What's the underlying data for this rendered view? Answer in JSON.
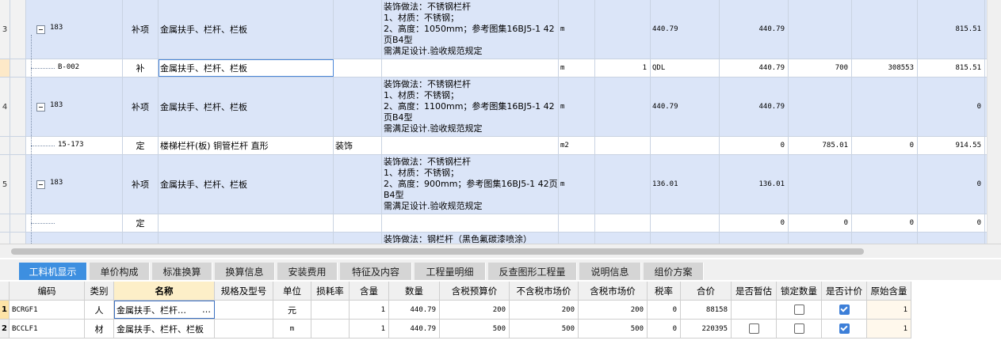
{
  "rows": [
    {
      "num": "3",
      "code": "183",
      "type": "补项",
      "name": "金属扶手、栏杆、栏板",
      "spec": "",
      "desc": [
        "装饰做法：不锈钢栏杆",
        "1、材质：不锈钢；",
        "2、高度：1050mm；参考图集16BJ5-1 42",
        "页B4型",
        "需满足设计.验收规范规定"
      ],
      "unit": "m",
      "qty": "",
      "qdl": "440.79",
      "v1": "440.79",
      "v2": "",
      "v3": "",
      "v4": "815.51"
    },
    {
      "num": "",
      "code": "B-002",
      "type": "补",
      "name": "金属扶手、栏杆、栏板",
      "spec": "",
      "desc": [],
      "unit": "m",
      "qty": "1",
      "qdl": "QDL",
      "v1": "440.79",
      "v2": "700",
      "v3": "308553",
      "v4": "815.51"
    },
    {
      "num": "4",
      "code": "183",
      "type": "补项",
      "name": "金属扶手、栏杆、栏板",
      "spec": "",
      "desc": [
        "装饰做法：不锈钢栏杆",
        "1、材质：不锈钢；",
        "2、高度：1100mm；参考图集16BJ5-1 42",
        "页B4型",
        "需满足设计.验收规范规定"
      ],
      "unit": "m",
      "qty": "",
      "qdl": "440.79",
      "v1": "440.79",
      "v2": "",
      "v3": "",
      "v4": "0"
    },
    {
      "num": "",
      "code": "15-173",
      "type": "定",
      "name": "楼梯栏杆(板) 铜管栏杆 直形",
      "spec": "装饰",
      "desc": [],
      "unit": "m2",
      "qty": "",
      "qdl": "",
      "v1": "0",
      "v2": "785.01",
      "v3": "0",
      "v4": "914.55"
    },
    {
      "num": "5",
      "code": "183",
      "type": "补项",
      "name": "金属扶手、栏杆、栏板",
      "spec": "",
      "desc": [
        "装饰做法：不锈钢栏杆",
        "1、材质：不锈钢；",
        "2、高度：900mm；参考图集16BJ5-1 42页",
        "B4型",
        "需满足设计.验收规范规定"
      ],
      "unit": "m",
      "qty": "",
      "qdl": "136.01",
      "v1": "136.01",
      "v2": "",
      "v3": "",
      "v4": "0"
    },
    {
      "num": "",
      "code": "",
      "type": "定",
      "name": "",
      "spec": "",
      "desc": [],
      "unit": "",
      "qty": "",
      "qdl": "",
      "v1": "0",
      "v2": "0",
      "v3": "0",
      "v4": "0"
    },
    {
      "num": "",
      "code": "",
      "type": "",
      "name": "",
      "spec": "",
      "desc": [
        "装饰做法：钢栏杆（黑色氟碳漆喷涂）"
      ],
      "unit": "",
      "qty": "",
      "qdl": "",
      "v1": "",
      "v2": "",
      "v3": "",
      "v4": ""
    }
  ],
  "tabs": [
    "工料机显示",
    "单价构成",
    "标准换算",
    "换算信息",
    "安装费用",
    "特征及内容",
    "工程量明细",
    "反查图形工程量",
    "说明信息",
    "组价方案"
  ],
  "bottom": {
    "headers": [
      "编码",
      "类别",
      "名称",
      "规格及型号",
      "单位",
      "损耗率",
      "含量",
      "数量",
      "含税预算价",
      "不含税市场价",
      "含税市场价",
      "税率",
      "合价",
      "是否暂估",
      "锁定数量",
      "是否计价",
      "原始含量"
    ],
    "rows": [
      {
        "num": "1",
        "code": "BCRGF1",
        "cat": "人",
        "name": "金属扶手、栏杆…",
        "more": "…",
        "spec": "",
        "unit": "元",
        "loss": "",
        "content": "1",
        "qty": "440.79",
        "p1": "200",
        "p2": "200",
        "p3": "200",
        "tax": "0",
        "total": "88158",
        "zg": null,
        "lock": false,
        "price": true,
        "orig": "1"
      },
      {
        "num": "2",
        "code": "BCCLF1",
        "cat": "材",
        "name": "金属扶手、栏杆、栏板",
        "more": "",
        "spec": "",
        "unit": "m",
        "loss": "",
        "content": "1",
        "qty": "440.79",
        "p1": "500",
        "p2": "500",
        "p3": "500",
        "tax": "0",
        "total": "220395",
        "zg": false,
        "lock": false,
        "price": true,
        "orig": "1"
      }
    ]
  }
}
